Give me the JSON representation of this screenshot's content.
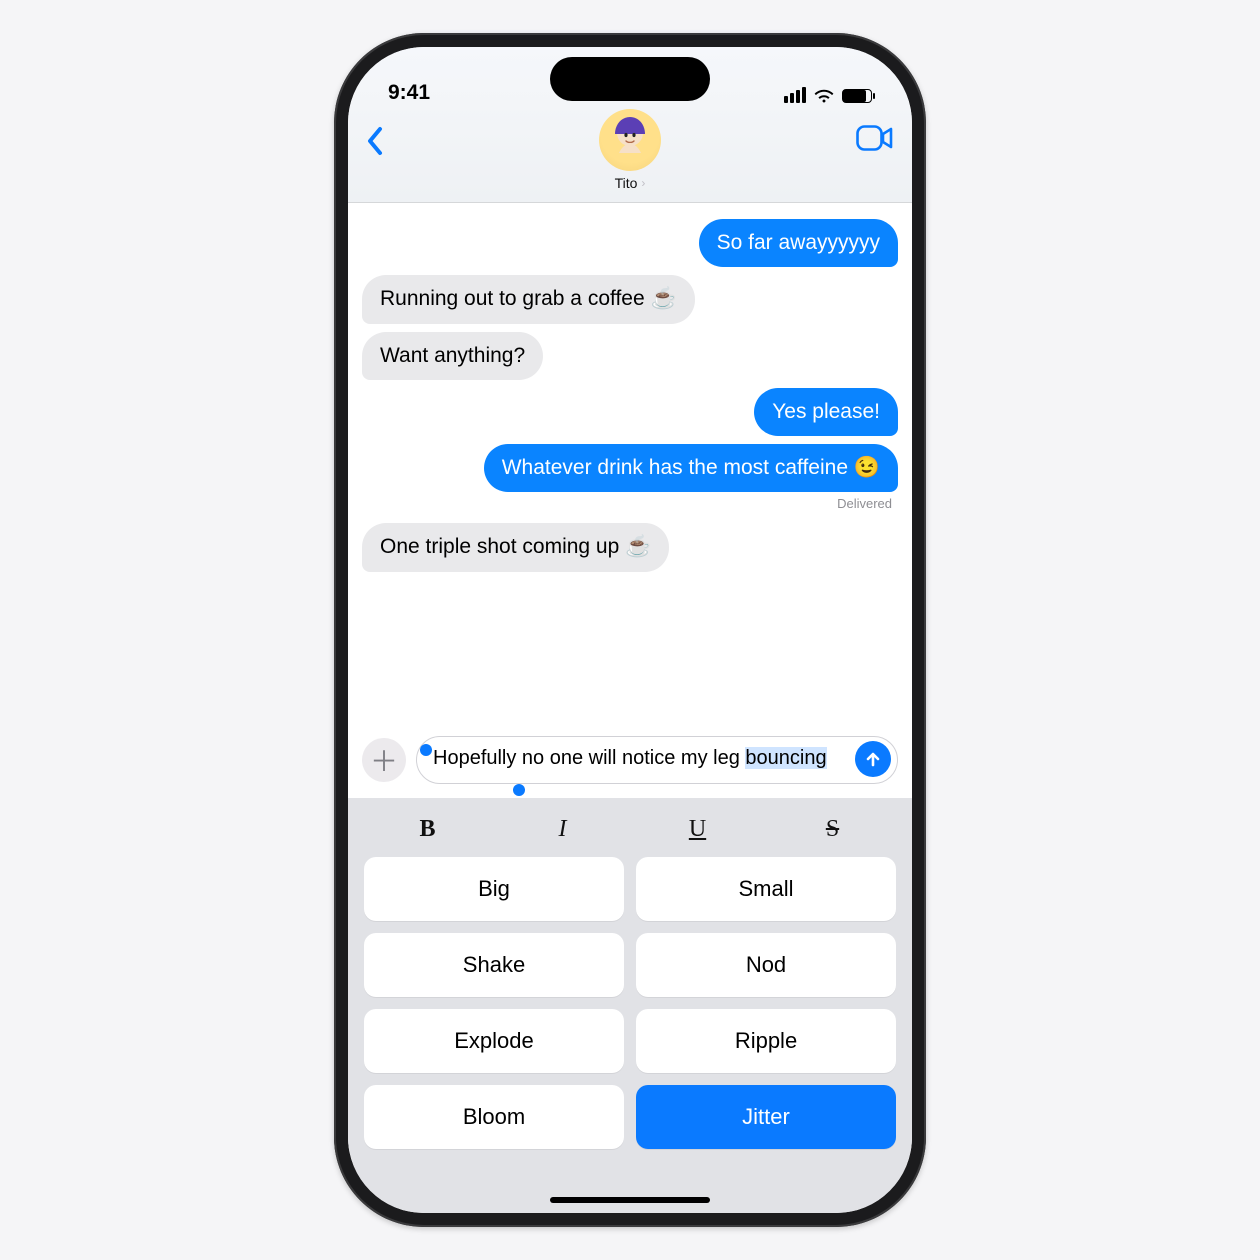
{
  "status": {
    "time": "9:41"
  },
  "header": {
    "contact_name": "Tito"
  },
  "messages": [
    {
      "side": "sent",
      "text": "So far awayyyyyy"
    },
    {
      "side": "recv",
      "text": "Running out to grab a coffee ☕️"
    },
    {
      "side": "recv",
      "text": "Want anything?"
    },
    {
      "side": "sent",
      "text": "Yes please!"
    },
    {
      "side": "sent",
      "text": "Whatever drink has the most caffeine 😉"
    },
    {
      "side": "recv",
      "text": "One triple shot coming up ☕️"
    }
  ],
  "delivered_label": "Delivered",
  "compose": {
    "text_full": "Hopefully no one will notice my leg bouncing",
    "text_prefix": "Hopefully no one will notice my leg ",
    "text_selected": "bouncing"
  },
  "format_bar": {
    "bold": "B",
    "italic": "I",
    "underline": "U",
    "strike": "S"
  },
  "effects": [
    {
      "label": "Big",
      "selected": false
    },
    {
      "label": "Small",
      "selected": false
    },
    {
      "label": "Shake",
      "selected": false
    },
    {
      "label": "Nod",
      "selected": false
    },
    {
      "label": "Explode",
      "selected": false
    },
    {
      "label": "Ripple",
      "selected": false
    },
    {
      "label": "Bloom",
      "selected": false
    },
    {
      "label": "Jitter",
      "selected": true
    }
  ]
}
